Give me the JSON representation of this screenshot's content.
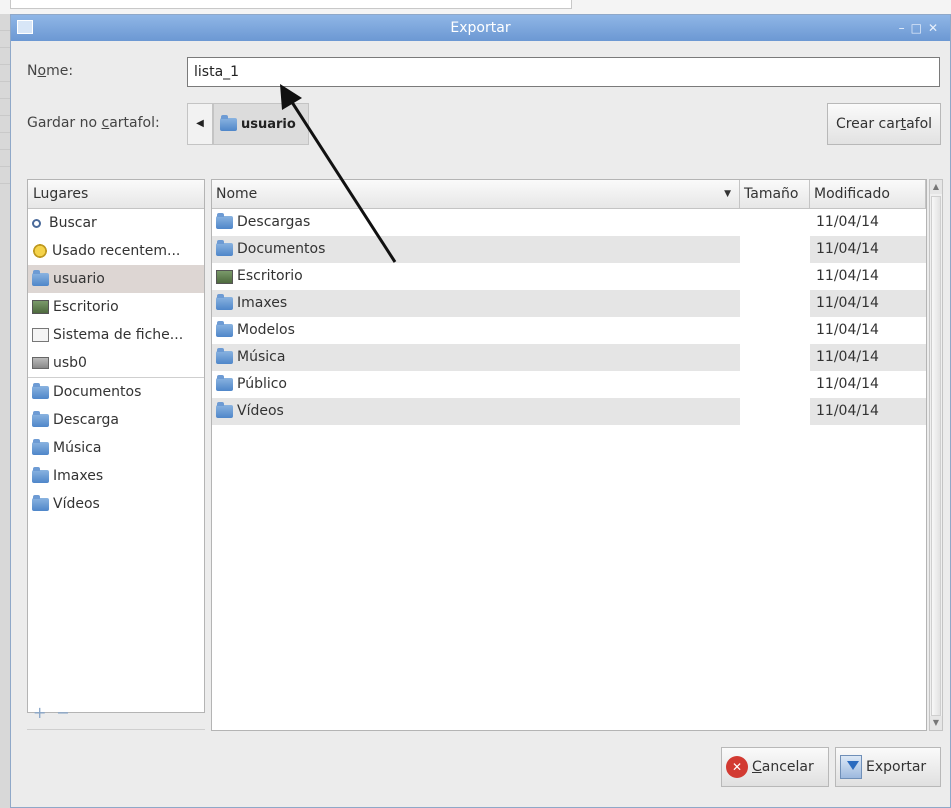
{
  "window": {
    "title": "Exportar"
  },
  "form": {
    "name_label_prefix": "N",
    "name_label_accel": "o",
    "name_label_suffix": "me:",
    "name_value": "lista_1",
    "folder_label_prefix": "Gardar no ",
    "folder_label_accel": "c",
    "folder_label_suffix": "artafol:",
    "current_folder": "usuario",
    "new_folder_prefix": "Crear car",
    "new_folder_accel": "t",
    "new_folder_suffix": "afol"
  },
  "places": {
    "header": "Lugares",
    "items": [
      {
        "label": "Buscar",
        "icon": "search-icon"
      },
      {
        "label": "Usado recentem...",
        "icon": "recent-icon"
      },
      {
        "label": "usuario",
        "icon": "folder-icon",
        "selected": true
      },
      {
        "label": "Escritorio",
        "icon": "desktop-icon"
      },
      {
        "label": "Sistema de fiche...",
        "icon": "filesystem-icon"
      },
      {
        "label": "usb0",
        "icon": "usb-drive-icon"
      },
      {
        "label": "Documentos",
        "icon": "folder-icon"
      },
      {
        "label": "Descarga",
        "icon": "folder-icon"
      },
      {
        "label": "Música",
        "icon": "folder-icon"
      },
      {
        "label": "Imaxes",
        "icon": "folder-icon"
      },
      {
        "label": "Vídeos",
        "icon": "folder-icon"
      }
    ],
    "add_symbol": "+",
    "remove_symbol": "−"
  },
  "files": {
    "columns": {
      "name": "Nome",
      "size": "Tamaño",
      "modified": "Modificado"
    },
    "rows": [
      {
        "name": "Descargas",
        "size": "",
        "modified": "11/04/14",
        "icon": "folder-icon"
      },
      {
        "name": "Documentos",
        "size": "",
        "modified": "11/04/14",
        "icon": "folder-icon"
      },
      {
        "name": "Escritorio",
        "size": "",
        "modified": "11/04/14",
        "icon": "desktop-icon"
      },
      {
        "name": "Imaxes",
        "size": "",
        "modified": "11/04/14",
        "icon": "folder-icon"
      },
      {
        "name": "Modelos",
        "size": "",
        "modified": "11/04/14",
        "icon": "folder-icon"
      },
      {
        "name": "Música",
        "size": "",
        "modified": "11/04/14",
        "icon": "folder-icon"
      },
      {
        "name": "Público",
        "size": "",
        "modified": "11/04/14",
        "icon": "folder-icon"
      },
      {
        "name": "Vídeos",
        "size": "",
        "modified": "11/04/14",
        "icon": "folder-icon"
      }
    ]
  },
  "buttons": {
    "cancel_accel": "C",
    "cancel_rest": "ancelar",
    "export_label": "Exportar"
  },
  "colors": {
    "titlebar": "#7aa4da",
    "selection": "#ddd6d3",
    "cancel_red": "#d23a32"
  }
}
